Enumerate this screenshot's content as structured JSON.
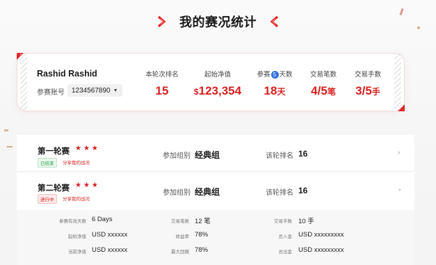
{
  "header": {
    "title": "我的赛况统计"
  },
  "colors": {
    "accent": "#d81e1e",
    "badge": "#2f6fde",
    "done": "#2aa24b"
  },
  "summary": {
    "user_name": "Rashid Rashid",
    "account_label": "参赛账号",
    "account_value": "1234567890",
    "stats": [
      {
        "label": "本轮次排名",
        "value": "15"
      },
      {
        "label": "起始净值",
        "currency": "$",
        "value": "123,354"
      },
      {
        "label_pre": "参赛",
        "badge": "5",
        "label_post": "天数",
        "value": "18",
        "unit": "天"
      },
      {
        "label": "交易笔数",
        "value": "4/5",
        "unit": "笔"
      },
      {
        "label": "交易手数",
        "value": "3/5",
        "unit": "手"
      }
    ]
  },
  "rounds": [
    {
      "name": "第一轮赛",
      "stars": "★★★",
      "status": "已结束",
      "share": "分享我的战况",
      "group_label": "参加组别",
      "group_value": "经典组",
      "rank_label": "该轮排名",
      "rank_value": "16",
      "expanded": false
    },
    {
      "name": "第二轮赛",
      "stars": "★★★",
      "status": "进行中",
      "share": "分享我的战况",
      "group_label": "参加组别",
      "group_value": "经典组",
      "rank_label": "该轮排名",
      "rank_value": "16",
      "expanded": true
    }
  ],
  "details": [
    {
      "label": "参赛有效天数",
      "value": "6 Days"
    },
    {
      "label": "交易笔数",
      "value": "12 笔"
    },
    {
      "label": "交易手数",
      "value": "10 手"
    },
    {
      "label": "起始净值",
      "value": "USD xxxxxx"
    },
    {
      "label": "收益率",
      "value": "78%"
    },
    {
      "label": "总入金",
      "value": "USD xxxxxxxxx"
    },
    {
      "label": "当前净值",
      "value": "USD xxxxxx"
    },
    {
      "label": "最大回撤",
      "value": "78%"
    },
    {
      "label": "总出金",
      "value": "USD xxxxxxxxx"
    }
  ]
}
